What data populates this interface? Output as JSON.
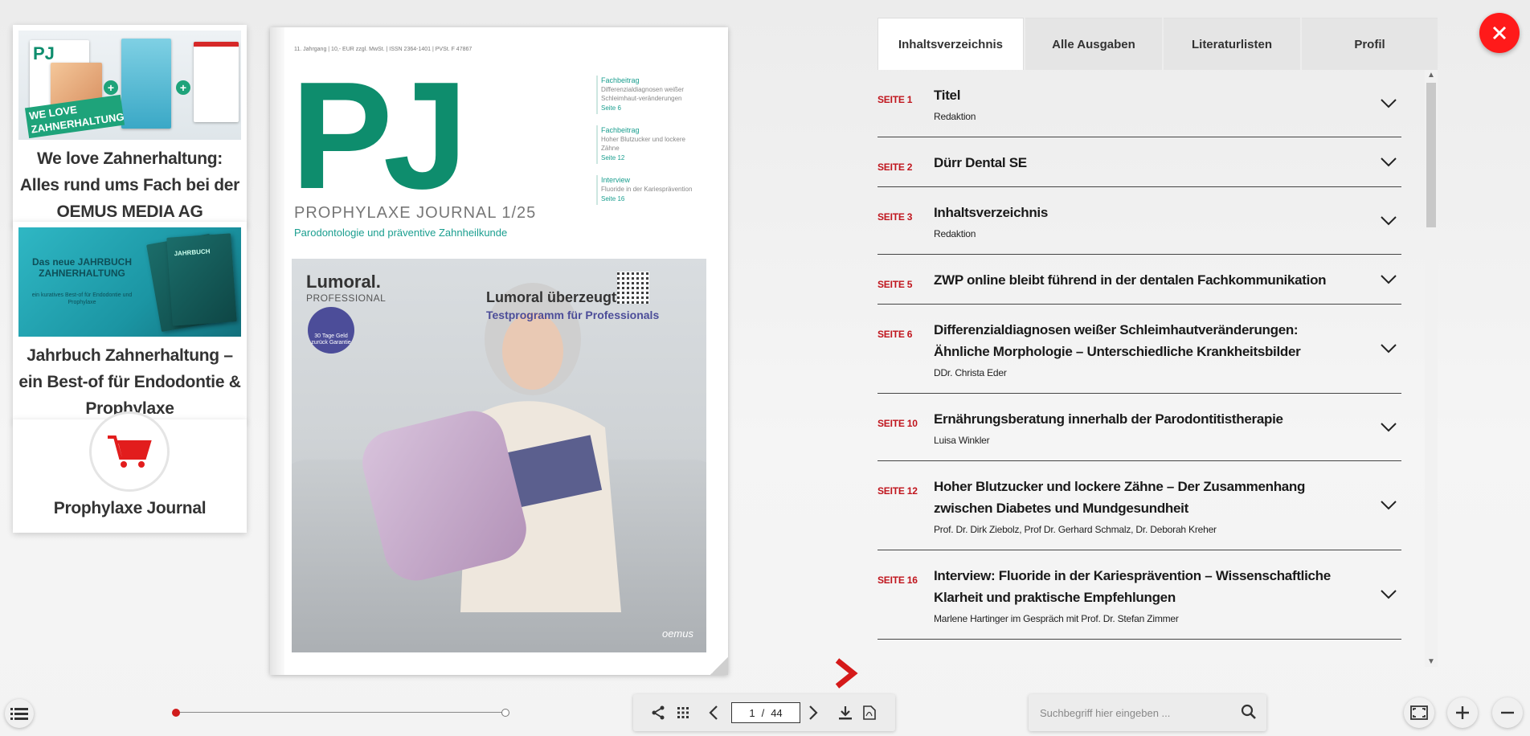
{
  "promos": [
    {
      "title": "We love Zahnerhaltung: Alles rund ums Fach bei der OEMUS MEDIA AG",
      "image_badge": "WE LOVE ZAHNERHALTUNG",
      "image_logo": "PJ"
    },
    {
      "title": "Jahrbuch Zahnerhaltung – ein Best-of für Endodontie & Prophylaxe",
      "image_headline": "Das neue JAHRBUCH ZAHNERHALTUNG",
      "image_sub": "ein kuratives Best-of für Endodontie und Prophylaxe",
      "image_book": "JAHRBUCH"
    },
    {
      "title": "Prophylaxe Journal",
      "icon": "shopping-cart-icon"
    }
  ],
  "cover": {
    "meta": "11. Jahrgang | 10,- EUR zzgl. MwSt. | ISSN 2364-1401 | PVSt. F 47867",
    "logo": "PJ",
    "title": "PROPHYLAXE JOURNAL 1/25",
    "subtitle": "Parodontologie und präventive Zahnheilkunde",
    "teasers": [
      {
        "kind": "Fachbeitrag",
        "desc": "Differenzialdiagnosen weißer Schleimhaut-veränderungen",
        "page": "Seite 6"
      },
      {
        "kind": "Fachbeitrag",
        "desc": "Hoher Blutzucker und lockere Zähne",
        "page": "Seite 12"
      },
      {
        "kind": "Interview",
        "desc": "Fluoride in der Kariesprävention",
        "page": "Seite 16"
      }
    ],
    "ad": {
      "brand": "Lumoral.",
      "brand_sub": "PROFESSIONAL",
      "badge": "30 Tage Geld zurück Garantie",
      "headline": "Lumoral überzeugt",
      "sub": "Testprogramm für Professionals",
      "logo": "oemus"
    }
  },
  "tabs": [
    {
      "label": "Inhaltsverzeichnis",
      "active": true
    },
    {
      "label": "Alle Ausgaben",
      "active": false
    },
    {
      "label": "Literaturlisten",
      "active": false
    },
    {
      "label": "Profil",
      "active": false
    }
  ],
  "toc": [
    {
      "page": "SEITE 1",
      "title": "Titel",
      "author": "Redaktion"
    },
    {
      "page": "SEITE 2",
      "title": "Dürr Dental SE",
      "author": ""
    },
    {
      "page": "SEITE 3",
      "title": "Inhaltsverzeichnis",
      "author": "Redaktion"
    },
    {
      "page": "SEITE 5",
      "title": "ZWP online bleibt führend in der dentalen Fachkommunikation",
      "author": ""
    },
    {
      "page": "SEITE 6",
      "title": "Differenzialdiagnosen weißer Schleimhautveränderungen: Ähnliche Morphologie – Unterschiedliche Krankheitsbilder",
      "author": "DDr. Christa Eder"
    },
    {
      "page": "SEITE 10",
      "title": "Ernährungsberatung innerhalb der Parodontitistherapie",
      "author": "Luisa Winkler"
    },
    {
      "page": "SEITE 12",
      "title": "Hoher Blutzucker und lockere Zähne – Der Zusammenhang zwischen Diabetes und Mundgesundheit",
      "author": "Prof. Dr. Dirk Ziebolz, Prof Dr. Gerhard Schmalz, Dr. Deborah Kreher"
    },
    {
      "page": "SEITE 16",
      "title": "Interview: Fluoride in der Kariesprävention – Wissenschaftliche Klarheit und praktische Empfehlungen",
      "author": "Marlene Hartinger im Gespräch mit Prof. Dr. Stefan Zimmer"
    }
  ],
  "pager": {
    "current": "1",
    "separator": "/",
    "total": "44"
  },
  "slider": {
    "progress": 0.0
  },
  "search": {
    "placeholder": "Suchbegriff hier eingeben ..."
  },
  "colors": {
    "accent": "#c0151d",
    "close": "#ff1a1a",
    "brand_green": "#0e8d6d"
  }
}
